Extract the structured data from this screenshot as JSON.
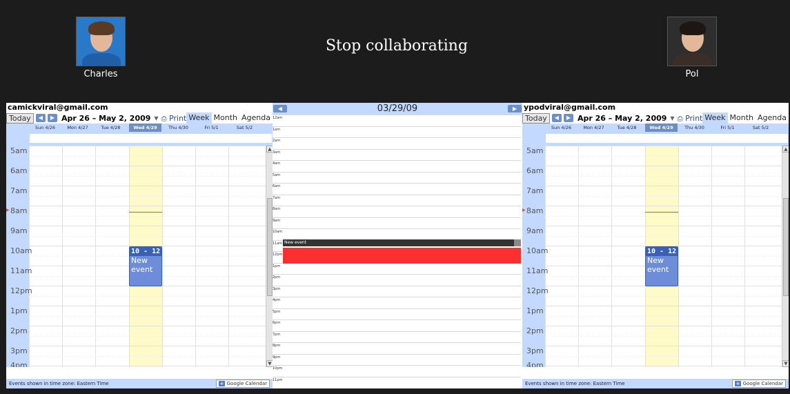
{
  "participants": {
    "left": {
      "name": "Charles"
    },
    "right": {
      "name": "Pol"
    }
  },
  "collab": {
    "stop_label": "Stop collaborating"
  },
  "left_cal": {
    "email": "camickviral@gmail.com",
    "today_label": "Today",
    "date_range": "Apr 26 – May 2, 2009",
    "print_label": "Print",
    "views": [
      "Week",
      "Month",
      "Agenda"
    ],
    "days": [
      "Sun 4/26",
      "Mon 4/27",
      "Tue 4/28",
      "Wed 4/29",
      "Thu 4/30",
      "Fri 5/1",
      "Sat 5/2"
    ],
    "hours": [
      "5am",
      "6am",
      "7am",
      "8am",
      "9am",
      "10am",
      "11am",
      "12pm",
      "1pm",
      "2pm",
      "3pm",
      "4pm"
    ],
    "event": {
      "time": "10 - 12:0",
      "title": "New event"
    },
    "footer": "Events shown in time zone: Eastern Time",
    "gcal_label": "Google Calendar"
  },
  "right_cal": {
    "email": "ypodviral@gmail.com",
    "today_label": "Today",
    "date_range": "Apr 26 – May 2, 2009",
    "print_label": "Print",
    "views": [
      "Week",
      "Month",
      "Agenda"
    ],
    "days": [
      "Sun 4/26",
      "Mon 4/27",
      "Tue 4/28",
      "Wed 4/29",
      "Thu 4/30",
      "Fri 5/1",
      "Sat 5/2"
    ],
    "hours": [
      "5am",
      "6am",
      "7am",
      "8am",
      "9am",
      "10am",
      "11am",
      "12pm",
      "1pm",
      "2pm",
      "3pm",
      "4pm"
    ],
    "event": {
      "time": "10 - 12:0",
      "title": "New event"
    },
    "footer": "Events shown in time zone: Eastern Time",
    "gcal_label": "Google Calendar"
  },
  "mid": {
    "date": "03/29/09",
    "hours": [
      "12am",
      "1am",
      "2am",
      "3am",
      "4am",
      "5am",
      "6am",
      "7am",
      "8am",
      "9am",
      "10am",
      "11am",
      "12pm",
      "1pm",
      "2pm",
      "3pm",
      "4pm",
      "5pm",
      "6pm",
      "7pm",
      "8pm",
      "9pm",
      "10pm",
      "11pm"
    ],
    "event_title": "New event"
  },
  "colors": {
    "event_blue": "#6d8dd8",
    "today_column": "#fffbc8",
    "mid_event": "#ff2f2f",
    "header_blue": "#c3d9ff"
  }
}
